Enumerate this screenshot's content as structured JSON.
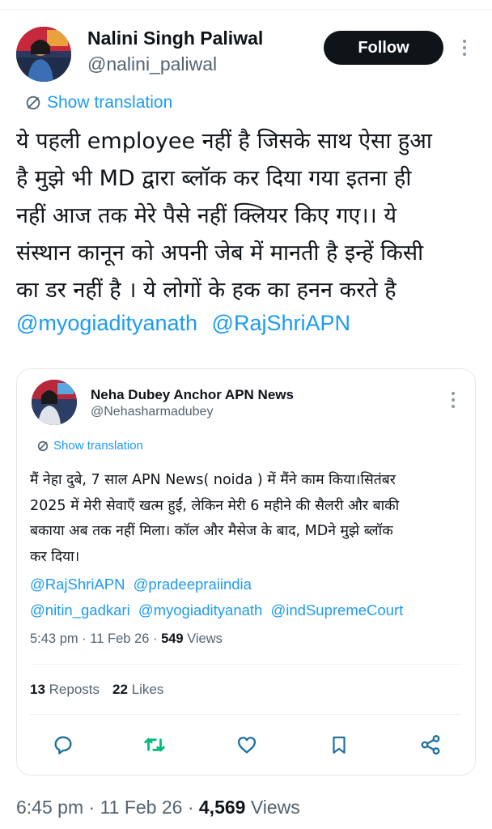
{
  "author": {
    "name": "Nalini Singh Paliwal",
    "handle": "@nalini_paliwal",
    "avatar_icon": "profile-photo"
  },
  "follow_label": "Follow",
  "show_translation": "Show translation",
  "tweet": {
    "lines": [
      "ये पहली employee नहीं है जिसके साथ ऐसा हुआ",
      "है मुझे भी MD द्वारा ब्लॉक कर दिया गया इतना ही",
      "नहीं आज तक मेरे पैसे नहीं क्लियर किए गए।। ये",
      "संस्थान कानून को अपनी जेब में मानती है इन्हें किसी",
      "का डर नहीं है । ये लोगों के हक का हनन करते है"
    ],
    "mentions": [
      "@myogiadityanath",
      "@RajShriAPN"
    ]
  },
  "quoted": {
    "name": "Neha Dubey Anchor APN News",
    "handle": "@Nehasharmadubey",
    "show_translation": "Show translation",
    "lines": [
      "मैं नेहा दुबे, 7 साल APN News( noida ) में मैंने काम किया।सितंबर",
      "2025 में मेरी सेवाएँ खत्म हुईं, लेकिन मेरी 6 महीने की सैलरी और बाकी",
      "बकाया अब तक नहीं मिला। कॉल और मैसेज के बाद, MDने मुझे ब्लॉक",
      "कर दिया।"
    ],
    "mentions_line1": [
      "@RajShriAPN",
      "@pradeepraiindia"
    ],
    "mentions_line2": [
      "@nitin_gadkari",
      "@myogiadityanath",
      "@indSupremeCourt"
    ],
    "time": "5:43 pm",
    "date": "11 Feb 26",
    "views_count": "549",
    "views_label": "Views",
    "reposts_count": "13",
    "reposts_label": "Reposts",
    "likes_count": "22",
    "likes_label": "Likes"
  },
  "actions": [
    "reply-icon",
    "repost-icon",
    "like-icon",
    "bookmark-icon",
    "share-icon"
  ],
  "colors": {
    "link": "#1d9bf0",
    "text": "#0f1419",
    "secondary": "#536471",
    "repost_active": "#00ba7c",
    "follow_bg": "#0f1419"
  },
  "meta": {
    "time": "6:45 pm",
    "date": "11 Feb 26",
    "views_count": "4,569",
    "views_label": "Views"
  }
}
